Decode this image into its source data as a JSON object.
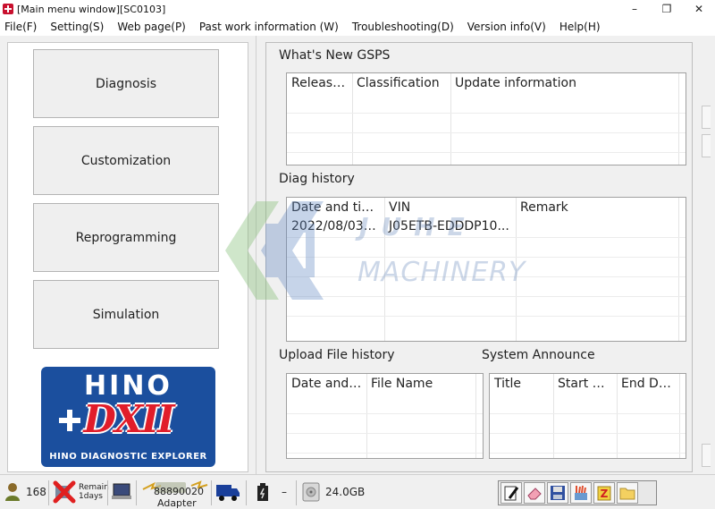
{
  "window": {
    "title": "[Main menu window][SC0103]",
    "controls": {
      "minimize": "–",
      "maximize": "❐",
      "close": "✕"
    }
  },
  "menu": [
    {
      "label": "File(F)"
    },
    {
      "label": "Setting(S)"
    },
    {
      "label": "Web page(P)"
    },
    {
      "label": "Past work information (W)"
    },
    {
      "label": "Troubleshooting(D)"
    },
    {
      "label": "Version info(V)"
    },
    {
      "label": "Help(H)"
    }
  ],
  "nav": {
    "diagnosis": "Diagnosis",
    "customization": "Customization",
    "reprogramming": "Reprogramming",
    "simulation": "Simulation"
  },
  "logo": {
    "brand": "HINO",
    "product": "DXII",
    "tagline": "HINO DIAGNOSTIC EXPLORER",
    "colors": {
      "blue": "#1b4f9e",
      "red": "#e11d2a"
    }
  },
  "whats_new": {
    "title": "What's New GSPS",
    "columns": [
      "Release...",
      "Classification",
      "Update information"
    ],
    "rows": []
  },
  "diag_history": {
    "title": "Diag history",
    "columns": [
      "Date and time",
      "VIN",
      "Remark"
    ],
    "rows": [
      [
        "2022/08/03 1...",
        "J05ETB-EDDDP10...",
        ""
      ]
    ]
  },
  "upload_history": {
    "title": "Upload File history",
    "columns": [
      "Date and t...",
      "File Name"
    ],
    "rows": []
  },
  "system_announce": {
    "title": "System Announce",
    "columns": [
      "Title",
      "Start D...",
      "End Dat..."
    ],
    "rows": []
  },
  "watermark": {
    "line1": "JUHE",
    "line2": "MACHINERY"
  },
  "status": {
    "user_count": "168",
    "remain_label": "Remain",
    "remain_days": "1days",
    "adapter_id": "88890020",
    "adapter_label": "Adapter",
    "battery_value": "–",
    "disk_free": "24.0GB"
  },
  "icons": {
    "user": "user-icon",
    "license": "license-x-icon",
    "laptop": "laptop-icon",
    "adapter": "adapter-icon",
    "truck": "truck-icon",
    "battery": "battery-icon",
    "disk": "disk-icon"
  }
}
